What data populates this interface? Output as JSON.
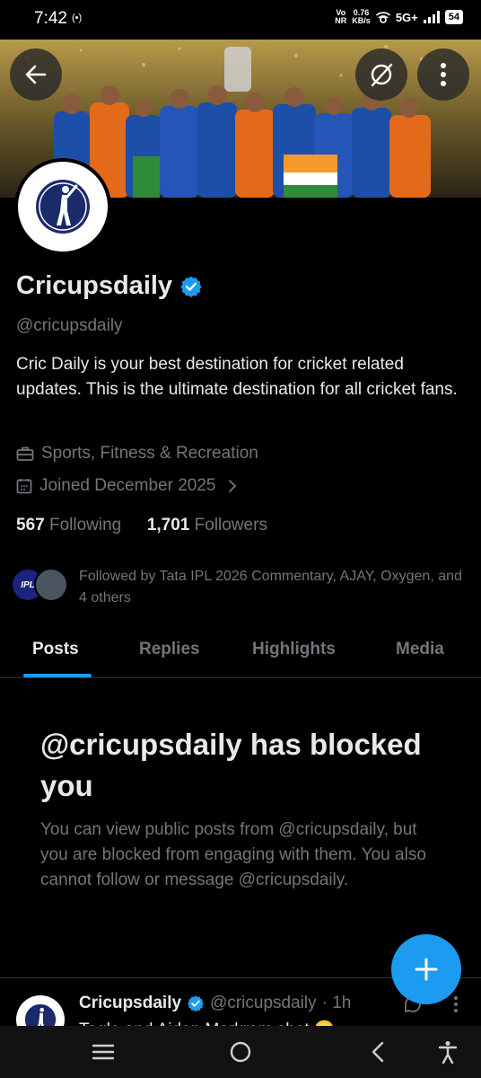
{
  "status_bar": {
    "time": "7:42",
    "hotspot": "(•)",
    "volte_top": "Vo",
    "volte_bottom": "NR",
    "speed_top": "0.76",
    "speed_bottom": "KB/s",
    "network": "5G+",
    "battery": "54"
  },
  "profile": {
    "name": "Cricupsdaily",
    "verified": true,
    "handle": "@cricupsdaily",
    "bio": "Cric Daily is your best destination for cricket related updates. This is the ultimate destination for all cricket fans.",
    "category": "Sports, Fitness & Recreation",
    "joined": "Joined December 2025",
    "following_count": "567",
    "following_label": "Following",
    "followers_count": "1,701",
    "followers_label": "Followers",
    "followed_by": "Followed by Tata IPL 2026 Commentary, AJAY, Oxygen, and 4 others",
    "ipl_badge": "IPL"
  },
  "tabs": [
    {
      "label": "Posts",
      "active": true
    },
    {
      "label": "Replies",
      "active": false
    },
    {
      "label": "Highlights",
      "active": false
    },
    {
      "label": "Media",
      "active": false
    }
  ],
  "blocked": {
    "title": "@cricupsdaily has blocked you",
    "text": "You can view public posts from @cricupsdaily, but you are blocked from engaging with them. You also cannot follow or message @cricupsdaily."
  },
  "post": {
    "name": "Cricupsdaily",
    "handle": "@cricupsdaily",
    "time": "· 1h",
    "text": "Tagle and Aiden Markram shot 😊"
  },
  "icons": {
    "back": "back-arrow-icon",
    "grok": "grok-icon",
    "more": "more-vertical-icon",
    "verified": "verified-badge-icon",
    "category": "briefcase-icon",
    "calendar": "calendar-icon",
    "chevron": "chevron-right-icon",
    "compose": "plus-icon"
  },
  "colors": {
    "accent": "#1d9bf0",
    "background": "#000000",
    "secondary_text": "#71767b",
    "primary_text": "#e7e9ea"
  }
}
